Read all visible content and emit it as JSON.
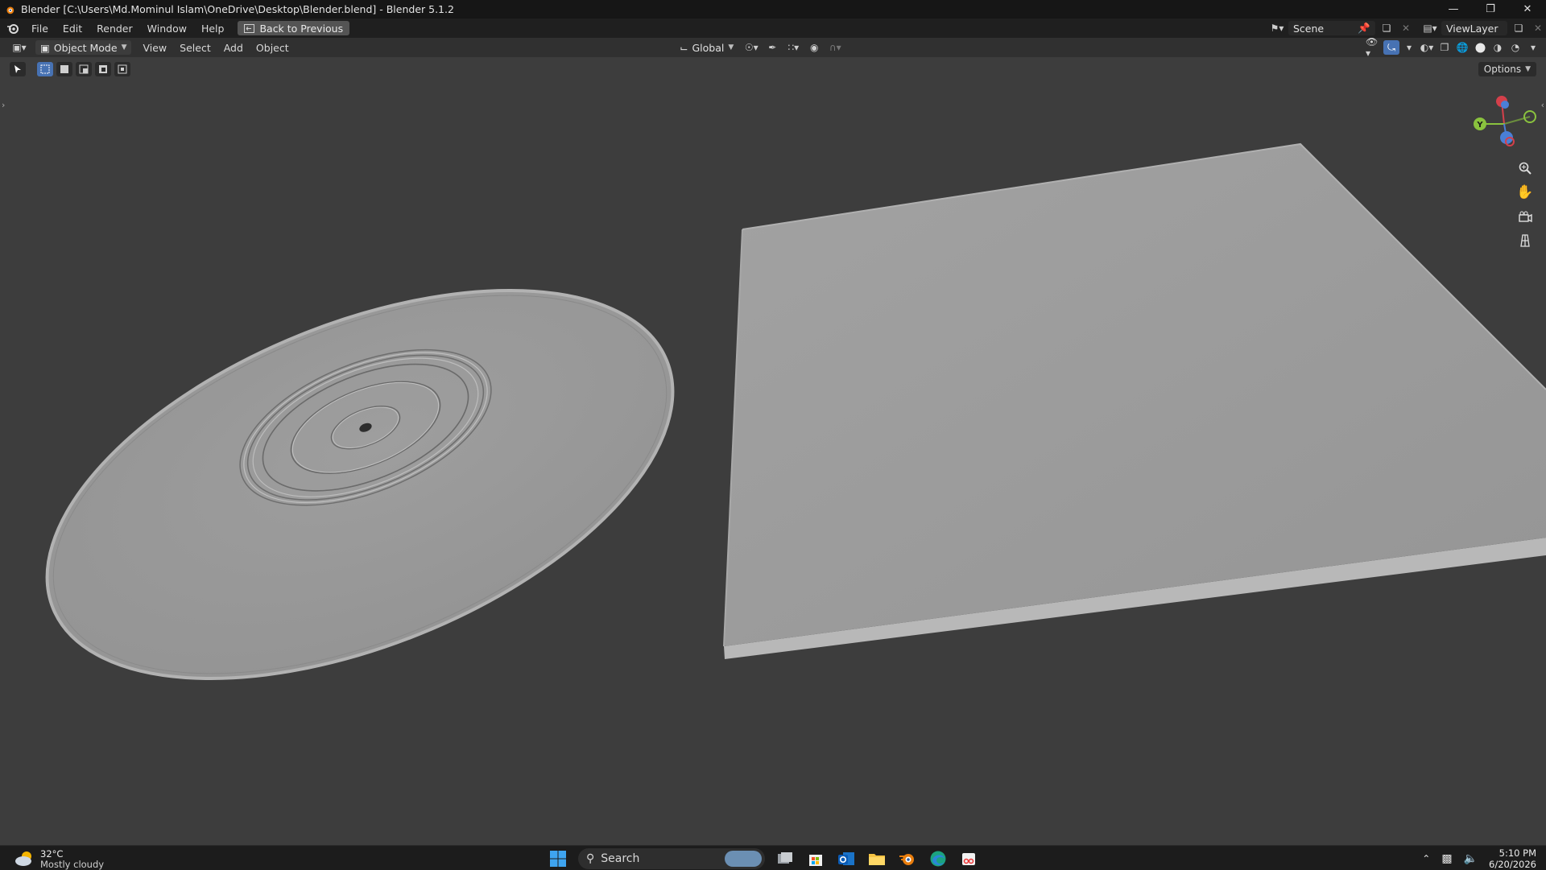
{
  "window": {
    "title": "Blender [C:\\Users\\Md.Mominul Islam\\OneDrive\\Desktop\\Blender.blend] - Blender 5.1.2"
  },
  "menubar": {
    "items": [
      "File",
      "Edit",
      "Render",
      "Window",
      "Help"
    ],
    "back_button": "Back to Previous",
    "scene": "Scene",
    "view_layer": "ViewLayer"
  },
  "header": {
    "mode": "Object Mode",
    "menus": [
      "View",
      "Select",
      "Add",
      "Object"
    ],
    "transform_orientation": "Global",
    "options_label": "Options"
  },
  "gizmo": {
    "y_label": "Y",
    "colors": {
      "x": "#d4404b",
      "y": "#8ac23e",
      "z": "#4a7fd6"
    }
  },
  "scene_objects": [
    "vinyl-record",
    "album-sleeve"
  ],
  "taskbar": {
    "weather_temp": "32°C",
    "weather_condition": "Mostly cloudy",
    "search_placeholder": "Search",
    "time": "5:10 PM",
    "date": "6/20/2026"
  }
}
